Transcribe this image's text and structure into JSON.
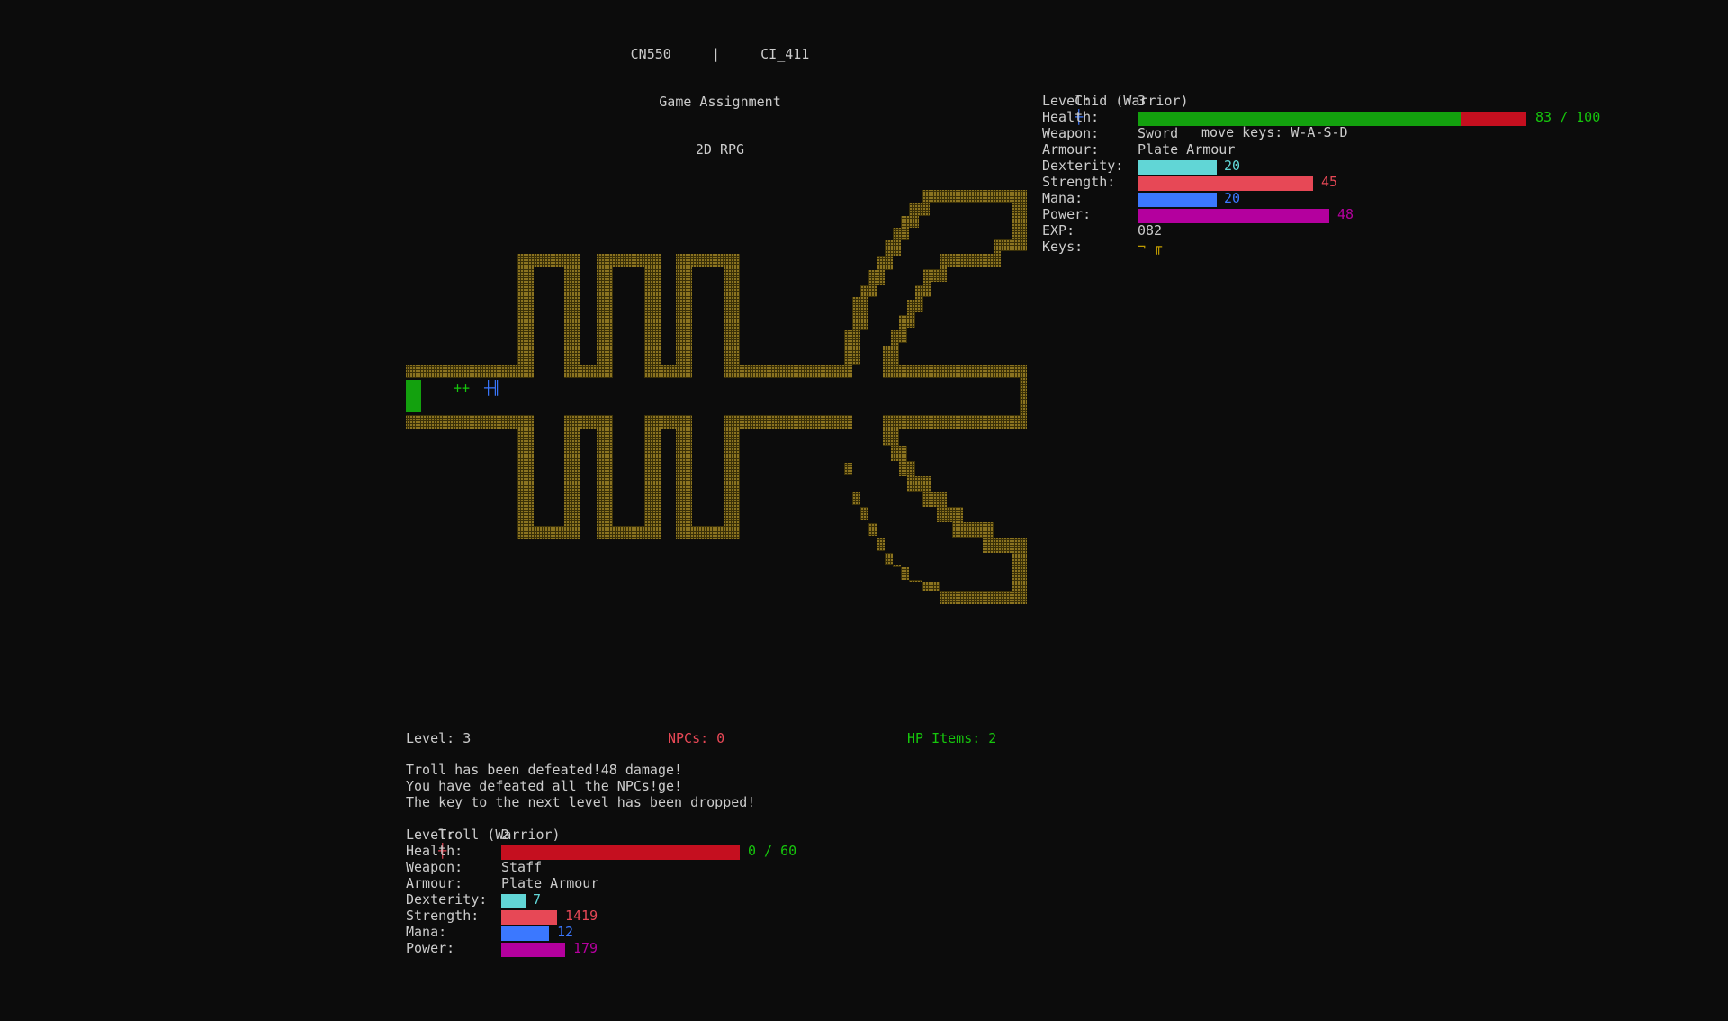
{
  "header": {
    "course_a": "CN550",
    "separator": "|",
    "course_b": "CI_411",
    "line2": "Game Assignment",
    "line3": "2D RPG"
  },
  "colors": {
    "background": "#0c0c0c",
    "text": "#cccccc",
    "wall": "#8b7320",
    "health_fill": "#13a10e",
    "health_empty": "#c50f1f",
    "health_text": "#16c60c",
    "dexterity": "#61d6d6",
    "strength": "#e74856",
    "mana": "#3b78ff",
    "power": "#b4009e",
    "player_icon": "#3b78ff",
    "enemy_icon": "#e74856",
    "hp_items": "#16c60c",
    "npcs": "#e74856"
  },
  "player": {
    "name": "Chid (Warrior)",
    "icon": "sword-icon",
    "icon_glyph": "┼",
    "move_keys": "move keys: W-A-S-D",
    "labels": {
      "level": "Level:",
      "health": "Health:",
      "weapon": "Weapon:",
      "armour": "Armour:",
      "dexterity": "Dexterity:",
      "strength": "Strength:",
      "mana": "Mana:",
      "power": "Power:",
      "exp": "EXP:",
      "keys": "Keys:"
    },
    "level": "3",
    "health": {
      "current": 83,
      "max": 100,
      "text": "83 / 100"
    },
    "weapon": "Sword",
    "armour": "Plate Armour",
    "dexterity": 20,
    "dexterity_text": "20",
    "strength": 45,
    "strength_text": "45",
    "mana": 20,
    "mana_text": "20",
    "power": 48,
    "power_text": "48",
    "exp": "082",
    "keys": "¬ ╓"
  },
  "map": {
    "exit_marker": "exit-door",
    "hp_items_glyph": "++",
    "player_glyph": "┼╢"
  },
  "status_bar": {
    "level": "Level: 3",
    "npcs": "NPCs: 0",
    "hp_items": "HP Items: 2"
  },
  "log": [
    "Troll has been defeated!48 damage!",
    "You have defeated all the NPCs!ge!",
    "The key to the next level has been dropped!"
  ],
  "enemy": {
    "name": "Troll (Warrior)",
    "icon": "dagger-icon",
    "icon_glyph": "┼",
    "labels": {
      "level": "Level:",
      "health": "Health:",
      "weapon": "Weapon:",
      "armour": "Armour:",
      "dexterity": "Dexterity:",
      "strength": "Strength:",
      "mana": "Mana:",
      "power": "Power:"
    },
    "level": "2",
    "health": {
      "current": 0,
      "max": 60,
      "text": "0 / 60"
    },
    "weapon": "Staff",
    "armour": "Plate Armour",
    "dexterity": 7,
    "dexterity_text": "7",
    "strength": 1419,
    "strength_text": "1419",
    "mana": 12,
    "mana_text": "12",
    "power": 179,
    "power_text": "179"
  }
}
